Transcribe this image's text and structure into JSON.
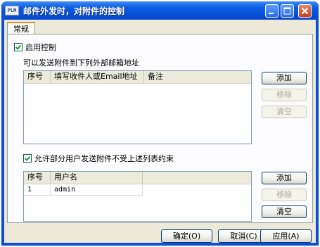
{
  "window": {
    "app_icon_text": "PLM",
    "title": "邮件外发时，对附件的控制"
  },
  "tabs": [
    {
      "label": "常规"
    }
  ],
  "enable_control": {
    "label": "启用控制",
    "checked": true
  },
  "external_section": {
    "label": "可以发送附件到下列外部邮箱地址",
    "columns": [
      "序号",
      "填写收件人或Email地址",
      "备注"
    ],
    "rows": [],
    "buttons": {
      "add": "添加",
      "remove": "移除",
      "clear": "清空"
    }
  },
  "allow_users": {
    "label": "允许部分用户发送附件不受上述列表约束",
    "checked": true
  },
  "users_section": {
    "columns": [
      "序号",
      "用户名"
    ],
    "rows": [
      {
        "index": "1",
        "username": "admin"
      }
    ],
    "buttons": {
      "add": "添加",
      "remove": "移除",
      "clear": "清空"
    }
  },
  "footer": {
    "ok": "确定(O)",
    "cancel": "取消(C)",
    "apply": "应用(A)"
  }
}
